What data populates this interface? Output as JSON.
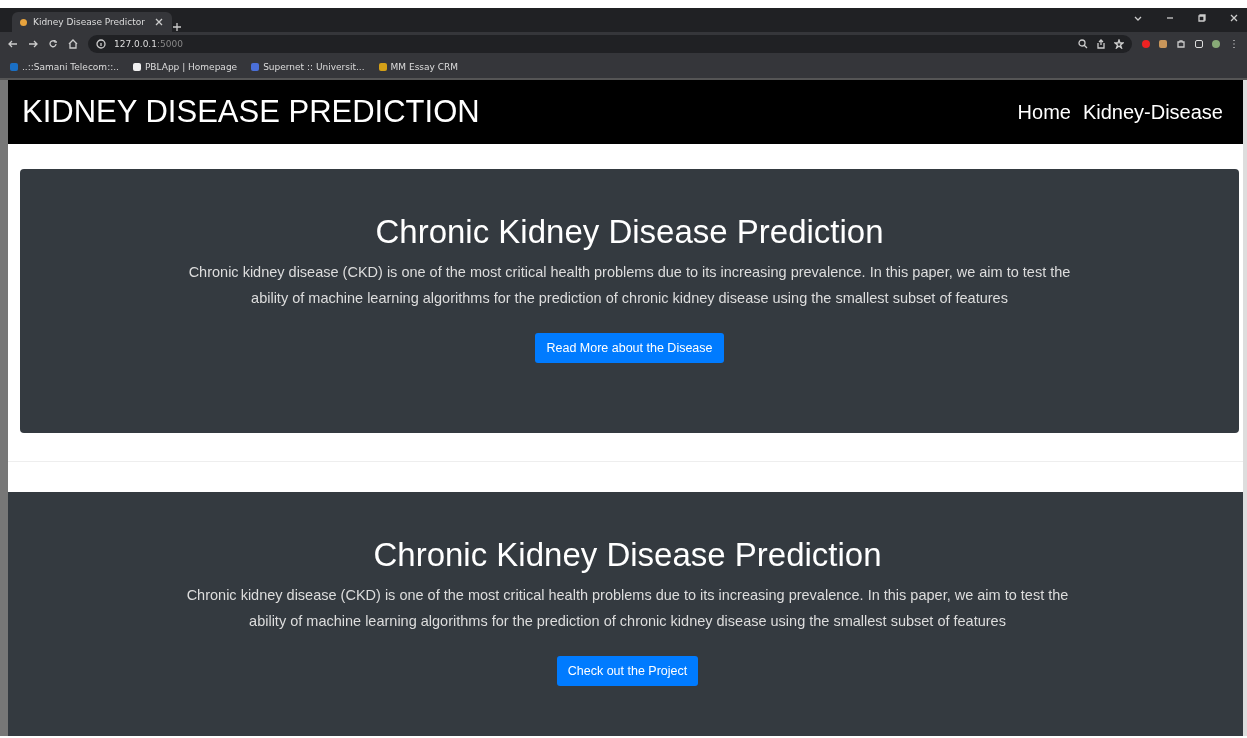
{
  "browser": {
    "tab_title": "Kidney Disease Predictor",
    "url_host": "127.0.0.1",
    "url_port": ":5000",
    "bookmarks": [
      "..::Samani Telecom::..",
      "PBLApp | Homepage",
      "Supernet :: Universit...",
      "MM Essay CRM"
    ]
  },
  "navbar": {
    "brand": "KIDNEY DISEASE PREDICTION",
    "links": [
      "Home",
      "Kidney-Disease"
    ]
  },
  "sections": [
    {
      "title": "Chronic Kidney Disease Prediction",
      "text": "Chronic kidney disease (CKD) is one of the most critical health problems due to its increasing prevalence. In this paper, we aim to test the ability of machine learning algorithms for the prediction of chronic kidney disease using the smallest subset of features",
      "button": "Read More about the Disease"
    },
    {
      "title": "Chronic Kidney Disease Prediction",
      "text": "Chronic kidney disease (CKD) is one of the most critical health problems due to its increasing prevalence. In this paper, we aim to test the ability of machine learning algorithms for the prediction of chronic kidney disease using the smallest subset of features",
      "button": "Check out the Project"
    }
  ]
}
